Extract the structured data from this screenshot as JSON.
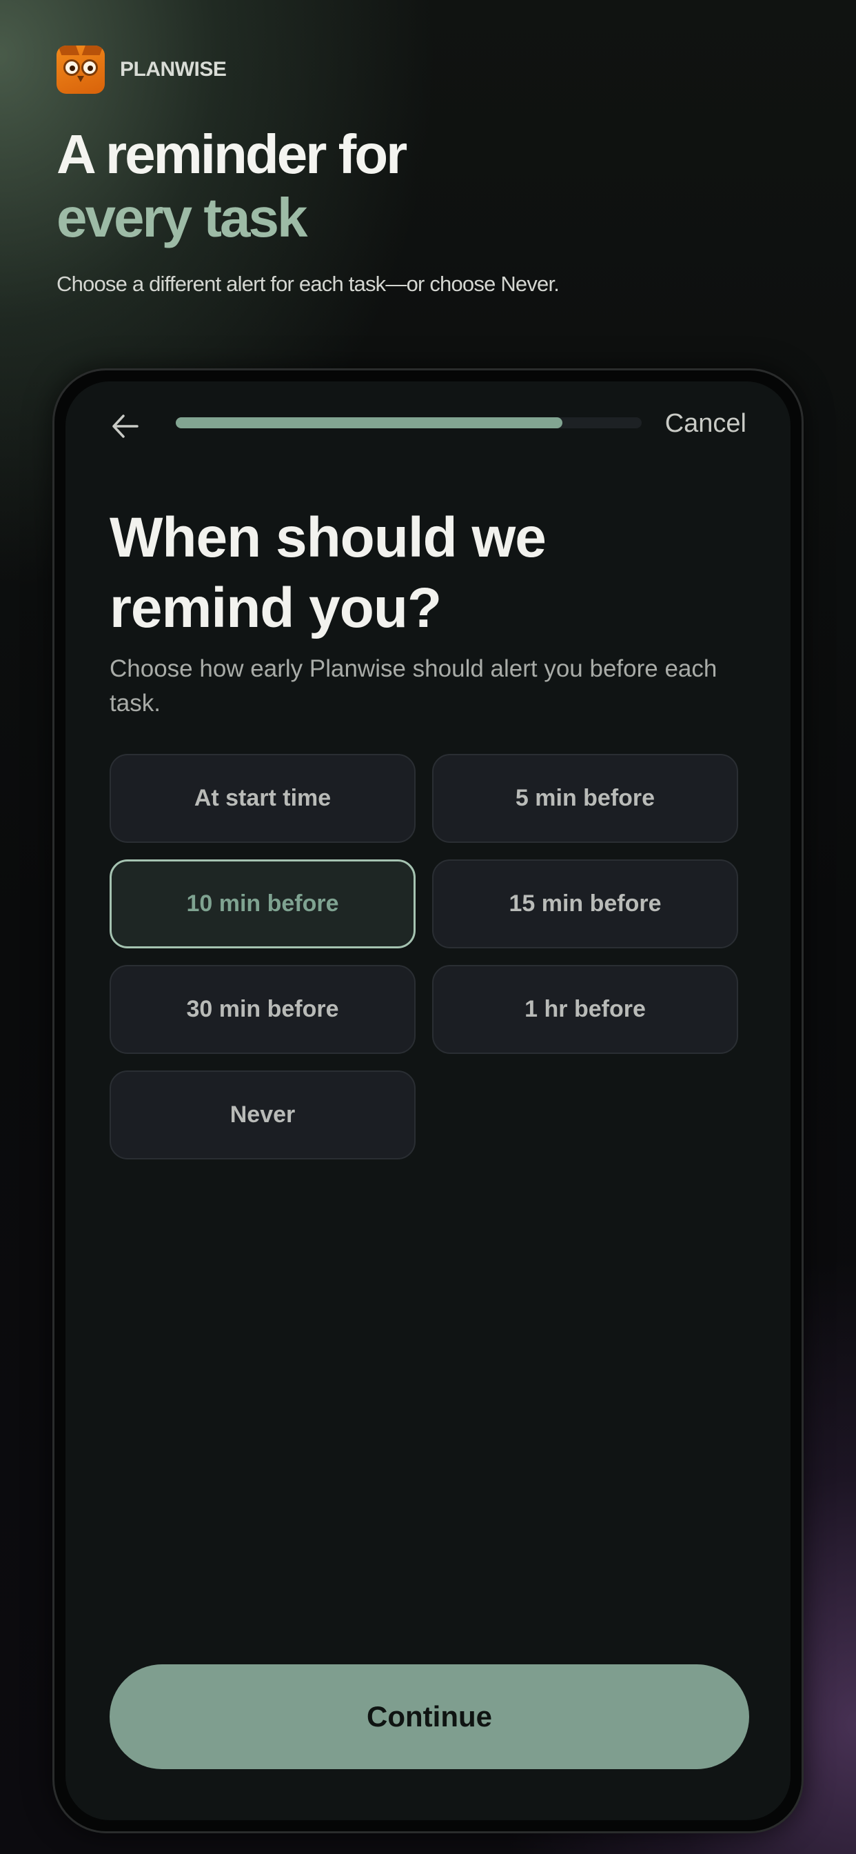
{
  "brand": {
    "name": "PLANWISE",
    "logo_icon": "owl-logo-icon"
  },
  "hero": {
    "title_line1": "A reminder for",
    "title_line2": "every task",
    "subtitle": "Choose a different alert for each task—or choose Never."
  },
  "topbar": {
    "back_icon": "arrow-left-icon",
    "progress": 0.83,
    "cancel_label": "Cancel"
  },
  "question": {
    "title": "When should we remind you?",
    "subtitle": "Choose how early Planwise should alert you before each task."
  },
  "options": [
    {
      "label": "At start time",
      "selected": false
    },
    {
      "label": "5 min before",
      "selected": false
    },
    {
      "label": "10 min before",
      "selected": true
    },
    {
      "label": "15 min before",
      "selected": false
    },
    {
      "label": "30 min before",
      "selected": false
    },
    {
      "label": "1 hr before",
      "selected": false
    },
    {
      "label": "Never",
      "selected": false
    }
  ],
  "continue_label": "Continue",
  "colors": {
    "accent": "#82a592",
    "accent_light": "#9dbba6",
    "background": "#101414",
    "brand_orange": "#f28a1c"
  }
}
